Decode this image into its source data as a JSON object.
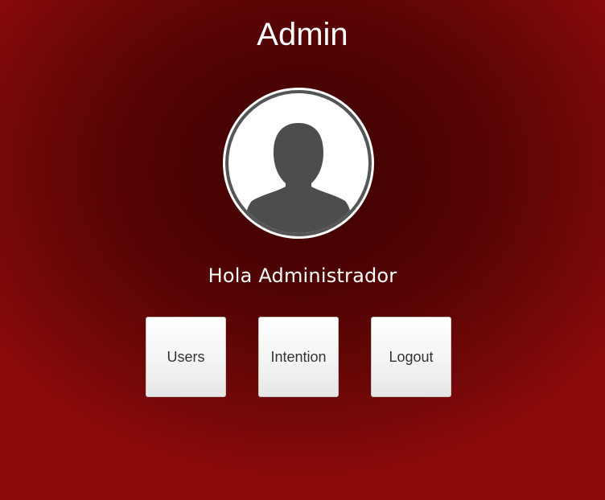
{
  "header": {
    "title": "Admin"
  },
  "profile": {
    "avatar_icon": "user-silhouette-icon",
    "greeting": "Hola Administrador"
  },
  "menu": {
    "users_label": "Users",
    "intention_label": "Intention",
    "logout_label": "Logout"
  },
  "colors": {
    "background_center": "#3e0000",
    "background_edge": "#8c0a0a",
    "avatar_ring": "#555555",
    "avatar_silhouette": "#4d4d4d",
    "button_text": "#333333"
  }
}
